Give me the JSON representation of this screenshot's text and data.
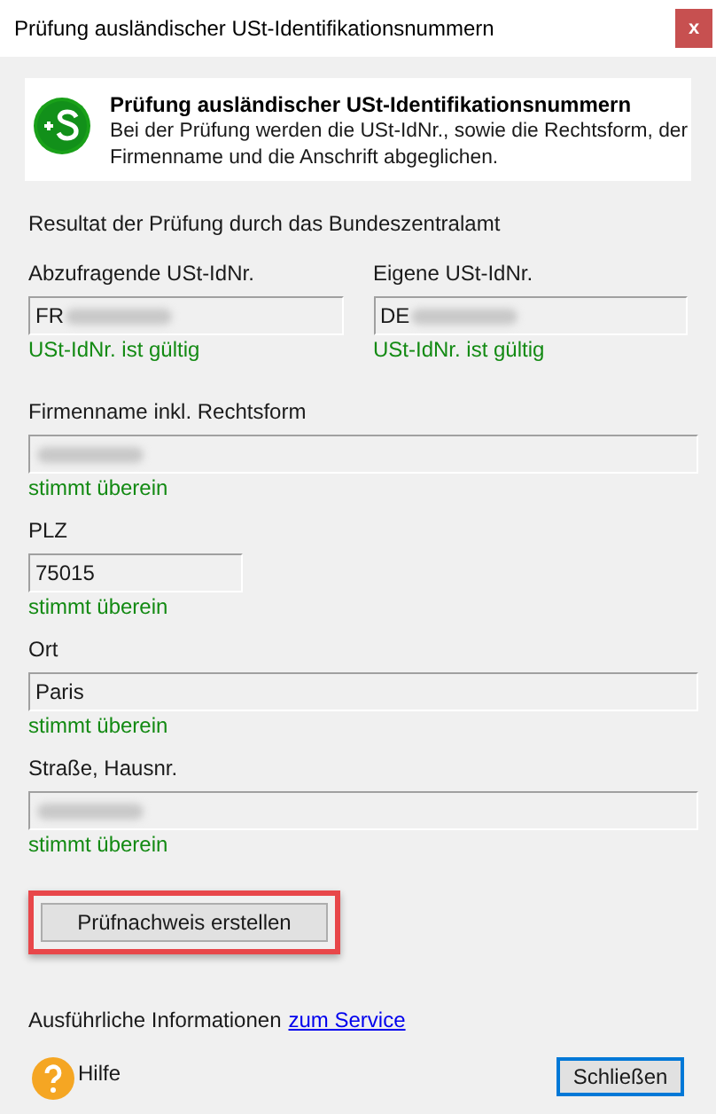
{
  "window": {
    "title": "Prüfung ausländischer USt-Identifikationsnummern",
    "close": "x"
  },
  "header": {
    "title": "Prüfung ausländischer USt-Identifikationsnummern",
    "text": "Bei der Prüfung werden die USt-IdNr., sowie die Rechtsform, der Firmenname und die Anschrift abgeglichen."
  },
  "result_heading": "Resultat der Prüfung durch das Bundeszentralamt",
  "id_numbers": [
    {
      "label": "Abzufragende USt-IdNr.",
      "value": "FR",
      "redacted": true,
      "status": "USt-IdNr. ist gültig"
    },
    {
      "label": "Eigene USt-IdNr.",
      "value": "DE",
      "redacted": true,
      "status": "USt-IdNr. ist gültig"
    }
  ],
  "fields": [
    {
      "kind": "wide",
      "label": "Firmenname inkl. Rechtsform",
      "redacted": true,
      "status": "stimmt überein"
    },
    {
      "kind": "short",
      "label": "PLZ",
      "value": "75015",
      "redacted": false,
      "status": "stimmt überein"
    },
    {
      "kind": "wide",
      "label": "Ort",
      "value": "Paris",
      "redacted": false,
      "status": "stimmt überein"
    },
    {
      "kind": "wide",
      "label": "Straße, Hausnr.",
      "redacted": true,
      "status": "stimmt überein"
    }
  ],
  "proof_button": {
    "label": "Prüfnachweis erstellen",
    "highlighted": true
  },
  "info": {
    "text": "Ausführliche Informationen",
    "link": "zum Service"
  },
  "footer": {
    "help": "Hilfe",
    "close_button": {
      "label": "Schließen",
      "focused": true
    }
  }
}
